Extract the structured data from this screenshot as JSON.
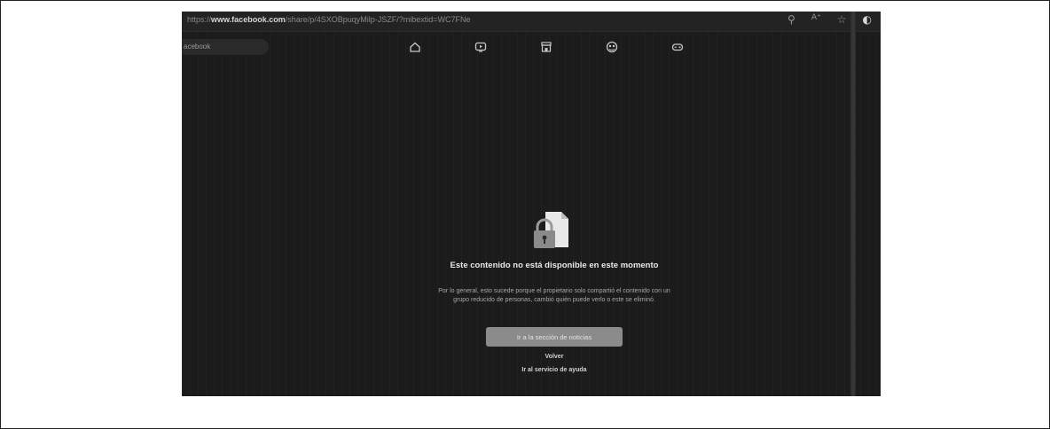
{
  "browser": {
    "url_prefix": "https://",
    "url_host": "www.facebook.com",
    "url_path": "/share/p/4SXOBpuqyMilp-JSZF/?mibextid=WC7FNe",
    "icons": [
      "zoom-icon",
      "read-aloud-icon",
      "favorite-star-icon",
      "edge-copilot-icon"
    ]
  },
  "facebook": {
    "tab_label": "acebook",
    "nav_icons": [
      "home-icon",
      "video-icon",
      "marketplace-icon",
      "groups-icon",
      "gaming-icon"
    ]
  },
  "message": {
    "title": "Este contenido no está disponible en este momento",
    "description": "Por lo general, esto sucede porque el propietario solo compartió el contenido con un grupo reducido de personas, cambió quién puede verlo o este se eliminó.",
    "primary_button": "Ir a la sección de noticias",
    "back_link": "Volver",
    "help_link": "Ir al servicio de ayuda"
  },
  "colors": {
    "background": "#1c1c1c",
    "button": "#8b8b8b",
    "lock_body": "#8a8a8a",
    "document": "#e9e9e9"
  }
}
